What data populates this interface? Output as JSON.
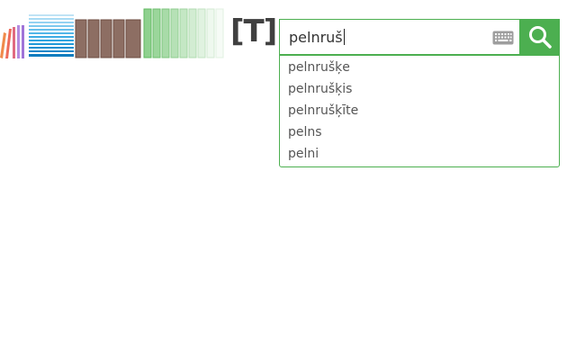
{
  "header": {
    "logo_text": "[T]:"
  },
  "search": {
    "value": "pelnruš",
    "keyboard_icon": "keyboard-icon",
    "button_icon": "search-icon"
  },
  "suggestions": [
    "pelnrušķe",
    "pelnrušķis",
    "pelnrušķīte",
    "pelns",
    "pelni"
  ],
  "colors": {
    "accent": "#4caf50",
    "logo_text": "#404040"
  }
}
